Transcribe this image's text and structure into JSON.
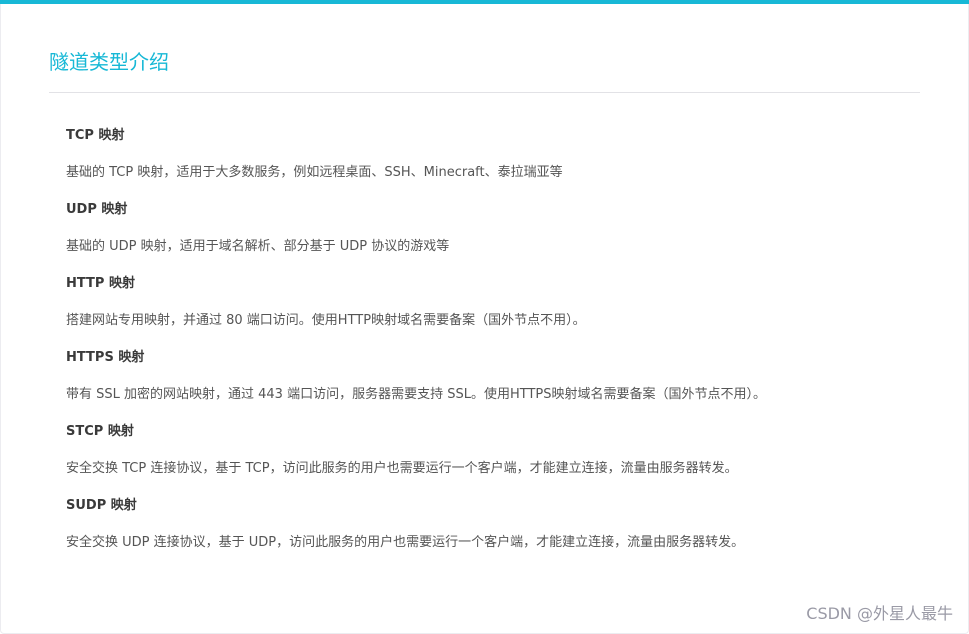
{
  "header": {
    "title": "隧道类型介绍"
  },
  "colors": {
    "accent": "#17b8d6",
    "text_heading": "#3a3a3a",
    "text_body": "#555555",
    "divider": "#e2e2e6"
  },
  "tunnel_types": [
    {
      "name": "TCP 映射",
      "description": "基础的 TCP 映射，适用于大多数服务，例如远程桌面、SSH、Minecraft、泰拉瑞亚等"
    },
    {
      "name": "UDP 映射",
      "description": "基础的 UDP 映射，适用于域名解析、部分基于 UDP 协议的游戏等"
    },
    {
      "name": "HTTP 映射",
      "description": "搭建网站专用映射，并通过 80 端口访问。使用HTTP映射域名需要备案（国外节点不用）。"
    },
    {
      "name": "HTTPS 映射",
      "description": "带有 SSL 加密的网站映射，通过 443 端口访问，服务器需要支持 SSL。使用HTTPS映射域名需要备案（国外节点不用）。"
    },
    {
      "name": "STCP 映射",
      "description": "安全交换 TCP 连接协议，基于 TCP，访问此服务的用户也需要运行一个客户端，才能建立连接，流量由服务器转发。"
    },
    {
      "name": "SUDP 映射",
      "description": "安全交换 UDP 连接协议，基于 UDP，访问此服务的用户也需要运行一个客户端，才能建立连接，流量由服务器转发。"
    }
  ],
  "watermark": "CSDN @外星人最牛"
}
